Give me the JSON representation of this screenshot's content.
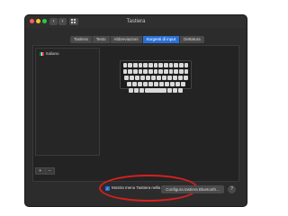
{
  "window": {
    "title": "Tastiera",
    "nav_back_icon": "chevron-left-icon",
    "nav_forward_icon": "chevron-right-icon",
    "grid_icon": "grid-icon"
  },
  "tabs": [
    {
      "label": "Tastiera",
      "active": false
    },
    {
      "label": "Testo",
      "active": false
    },
    {
      "label": "Abbreviazioni",
      "active": false
    },
    {
      "label": "Sorgenti di input",
      "active": true
    },
    {
      "label": "Dettatura",
      "active": false
    }
  ],
  "sources": {
    "items": [
      {
        "label": "Italiano",
        "flag_colors": [
          "#009246",
          "#ffffff",
          "#ce2b37"
        ]
      }
    ],
    "add_label": "+",
    "remove_label": "−"
  },
  "keyboard": {
    "rows": [
      [
        "",
        "",
        "",
        "",
        "",
        "",
        "",
        "",
        "",
        "",
        "",
        "",
        ""
      ],
      [
        "",
        "",
        "",
        "",
        "",
        "",
        "",
        "",
        "",
        "",
        "",
        "",
        ""
      ],
      [
        "",
        "",
        "",
        "",
        "",
        "",
        "",
        "",
        "",
        "",
        "",
        ""
      ],
      [
        "",
        "",
        "",
        "",
        "",
        "",
        "",
        "",
        "",
        "",
        ""
      ],
      [
        "",
        "",
        "",
        "space",
        "",
        "",
        ""
      ]
    ]
  },
  "options": {
    "show_menu_label": "Mostra menu Tastiera nella barra dei menu",
    "show_menu_checked": true
  },
  "buttons": {
    "bluetooth_label": "Configura tastiera Bluetooth...",
    "help_label": "?"
  },
  "colors": {
    "accent": "#2a6fd6",
    "highlight_circle": "#d91f1f"
  }
}
